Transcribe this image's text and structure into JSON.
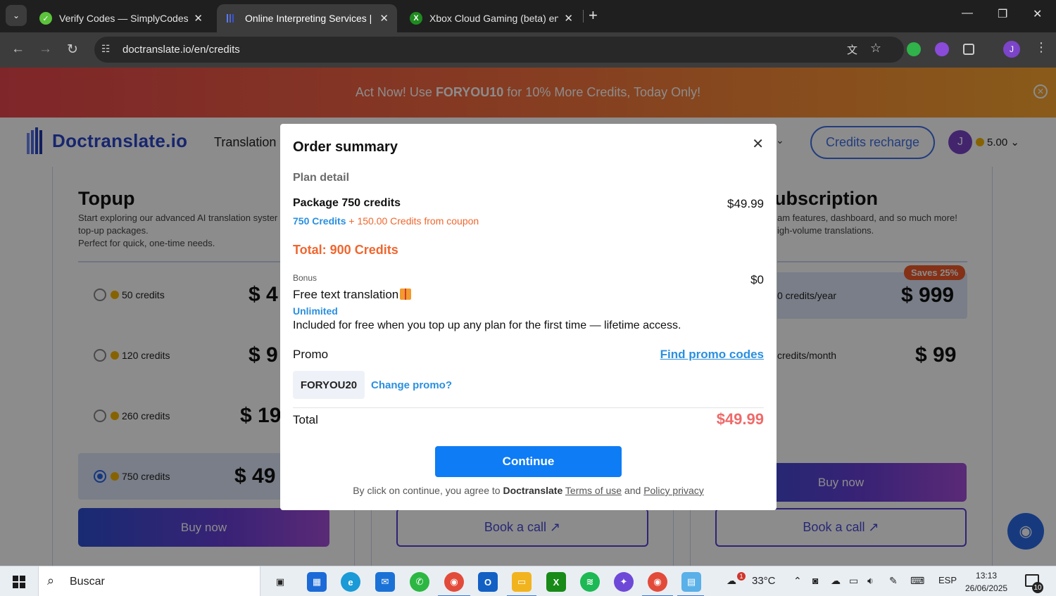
{
  "browser": {
    "tabs": [
      {
        "title": "Verify Codes — SimplyCodes",
        "favicon": "simplycodes-icon"
      },
      {
        "title": "Online Interpreting Services | En",
        "favicon": "doctranslate-icon",
        "active": true
      },
      {
        "title": "Xbox Cloud Gaming (beta) en X",
        "favicon": "xbox-icon"
      }
    ],
    "url": "doctranslate.io/en/credits",
    "profile_initial": "J"
  },
  "banner": {
    "text_before": "Act Now! Use ",
    "code": "FORYOU10",
    "text_after": " for 10% More Credits, Today Only!"
  },
  "header": {
    "logo": "Doctranslate.io",
    "nav_translation": "Translation",
    "credits_recharge": "Credits recharge",
    "avatar_initial": "J",
    "balance": "5.00"
  },
  "topup": {
    "title": "Topup",
    "desc_line1": "Start exploring our advanced AI translation syster",
    "desc_line2": "top-up packages.",
    "desc_line3": "Perfect for quick, one-time needs.",
    "options": [
      {
        "label": "50 credits",
        "price": "$ 4"
      },
      {
        "label": "120 credits",
        "price": "$ 9"
      },
      {
        "label": "260 credits",
        "price": "$ 19"
      },
      {
        "label": "750 credits",
        "price": "$ 49",
        "selected": true
      }
    ],
    "buy_now": "Buy now"
  },
  "middle": {
    "book_call": "Book a call ↗"
  },
  "subscription": {
    "title": "ubscription",
    "desc_line1": "am features, dashboard, and so much more!",
    "desc_line2": "igh-volume translations.",
    "save_badge": "Saves 25%",
    "options": [
      {
        "label": "0 credits/year",
        "price": "$ 999"
      },
      {
        "label": "credits/month",
        "price": "$ 99"
      }
    ],
    "buy_now": "Buy now",
    "book_call": "Book a call ↗"
  },
  "modal": {
    "title": "Order summary",
    "plan_detail": "Plan detail",
    "package_name": "Package 750 credits",
    "package_price": "$49.99",
    "credits_base": "750 Credits",
    "credits_coupon": "+ 150.00 Credits from coupon",
    "total_credits": "Total: 900 Credits",
    "bonus_label": "Bonus",
    "bonus_price": "$0",
    "bonus_name": "Free text translation",
    "bonus_unlimited": "Unlimited",
    "bonus_desc": "Included for free when you top up any plan for the first time — lifetime access.",
    "promo_label": "Promo",
    "find_promo": "Find promo codes",
    "promo_code": "FORYOU20",
    "change_promo": "Change promo?",
    "total_label": "Total",
    "total_value": "$49.99",
    "continue": "Continue",
    "legal_prefix": "By click on continue, you agree to ",
    "legal_brand": "Doctranslate",
    "terms": "Terms of use",
    "legal_and": " and ",
    "privacy": "Policy privacy"
  },
  "taskbar": {
    "search_placeholder": "Buscar",
    "weather_badge": "1",
    "temperature": "33°C",
    "language": "ESP",
    "time": "13:13",
    "date": "26/06/2025",
    "notifications": "10"
  }
}
